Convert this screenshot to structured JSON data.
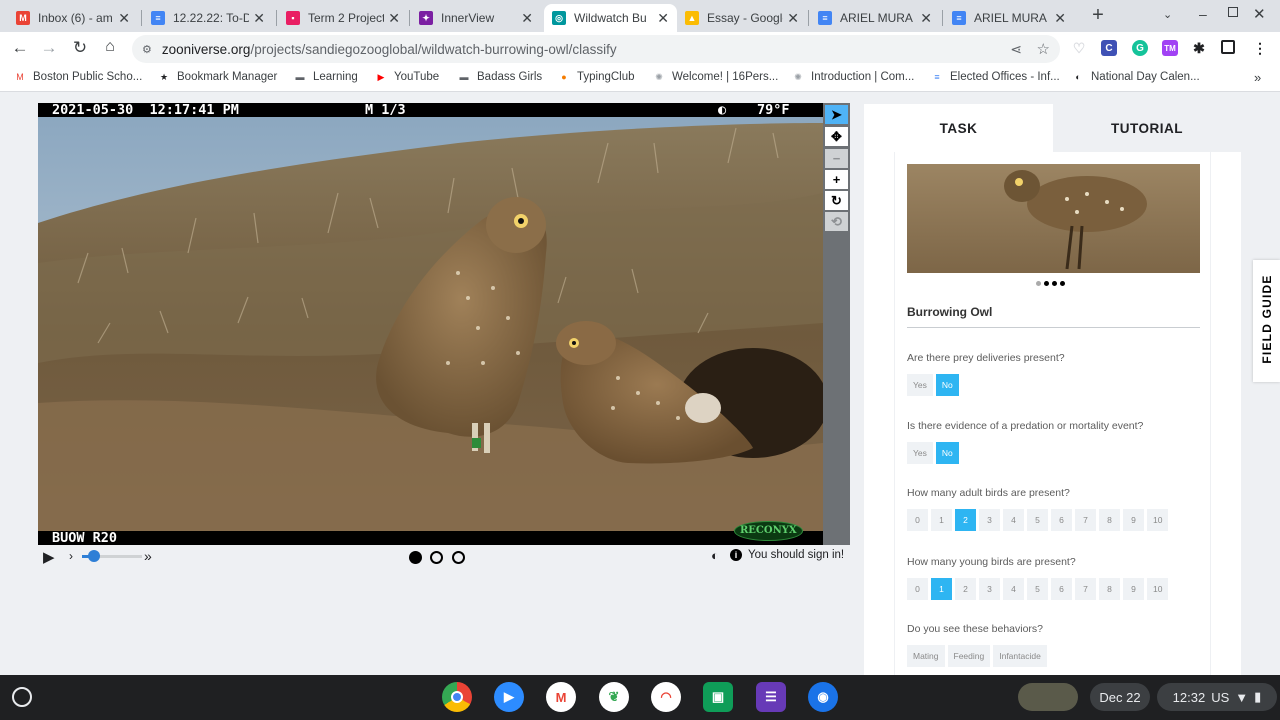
{
  "tabs": [
    {
      "title": "Inbox (6) - am",
      "icon": "gmail-icon",
      "color": "#ea4335",
      "letter": "M"
    },
    {
      "title": "12.22.22: To-D",
      "icon": "docs-icon",
      "color": "#4285f4",
      "letter": "≡"
    },
    {
      "title": "Term 2 Project",
      "icon": "classroom-icon",
      "color": "#e91e63",
      "letter": "▪"
    },
    {
      "title": "InnerView",
      "icon": "innerview-icon",
      "color": "#7b1fa2",
      "letter": "✦"
    },
    {
      "title": "Wildwatch Bu",
      "icon": "zooniverse-icon",
      "color": "#00979d",
      "letter": "◎"
    },
    {
      "title": "Essay - Google",
      "icon": "drive-icon",
      "color": "#fbbc04",
      "letter": "▲"
    },
    {
      "title": "ARIEL MURA -",
      "icon": "docs-icon",
      "color": "#4285f4",
      "letter": "≡"
    },
    {
      "title": "ARIEL MURA -",
      "icon": "docs-icon",
      "color": "#4285f4",
      "letter": "≡"
    }
  ],
  "url": {
    "host": "zooniverse.org",
    "path": "/projects/sandiegozooglobal/wildwatch-burrowing-owl/classify"
  },
  "bookmarks": [
    {
      "label": "Boston Public Scho...",
      "icon": "gmail-icon",
      "color": "#ea4335",
      "glyph": "M"
    },
    {
      "label": "Bookmark Manager",
      "icon": "star-icon",
      "color": "#202124",
      "glyph": "★"
    },
    {
      "label": "Learning",
      "icon": "folder-icon",
      "color": "#5f6368",
      "glyph": "▬"
    },
    {
      "label": "YouTube",
      "icon": "youtube-icon",
      "color": "#ff0000",
      "glyph": "▶"
    },
    {
      "label": "Badass Girls",
      "icon": "folder-icon",
      "color": "#5f6368",
      "glyph": "▬"
    },
    {
      "label": "TypingClub",
      "icon": "typingclub-icon",
      "color": "#f57c00",
      "glyph": "●"
    },
    {
      "label": "Welcome! | 16Pers...",
      "icon": "sixteen-icon",
      "color": "#9aa0a6",
      "glyph": "✺"
    },
    {
      "label": "Introduction | Com...",
      "icon": "sixteen-icon",
      "color": "#9aa0a6",
      "glyph": "✺"
    },
    {
      "label": "Elected Offices - Inf...",
      "icon": "docs-icon",
      "color": "#4285f4",
      "glyph": "≡"
    },
    {
      "label": "National Day Calen...",
      "icon": "globe-icon",
      "color": "#202124",
      "glyph": "◐"
    }
  ],
  "camera": {
    "datetime": "2021-05-30  12:17:41 PM",
    "frame": "M 1/3",
    "temp": "79°F",
    "site": "BUOW R20",
    "brand": "RECONYX"
  },
  "viewer": {
    "sign_in": "You should sign in!"
  },
  "panel": {
    "tab_task": "TASK",
    "tab_tutorial": "TUTORIAL",
    "species": "Burrowing Owl",
    "questions": [
      {
        "text": "Are there prey deliveries present?",
        "options": [
          "Yes",
          "No"
        ],
        "selected": "No"
      },
      {
        "text": "Is there evidence of a predation or mortality event?",
        "options": [
          "Yes",
          "No"
        ],
        "selected": "No"
      },
      {
        "text": "How many adult birds are present?",
        "options": [
          "0",
          "1",
          "2",
          "3",
          "4",
          "5",
          "6",
          "7",
          "8",
          "9",
          "10"
        ],
        "selected": "2"
      },
      {
        "text": "How many young birds are present?",
        "options": [
          "0",
          "1",
          "2",
          "3",
          "4",
          "5",
          "6",
          "7",
          "8",
          "9",
          "10"
        ],
        "selected": "1"
      },
      {
        "text": "Do you see these behaviors?",
        "options": [
          "Mating",
          "Feeding",
          "Infantacide"
        ],
        "selected": ""
      }
    ],
    "field_guide": "FIELD GUIDE"
  },
  "shelf": {
    "date": "Dec 22",
    "time": "12:32",
    "locale": "US"
  },
  "colors": {
    "accent": "#2eb5f2",
    "chrome_tab": "#dee1e6",
    "shelf": "#1f2022"
  }
}
